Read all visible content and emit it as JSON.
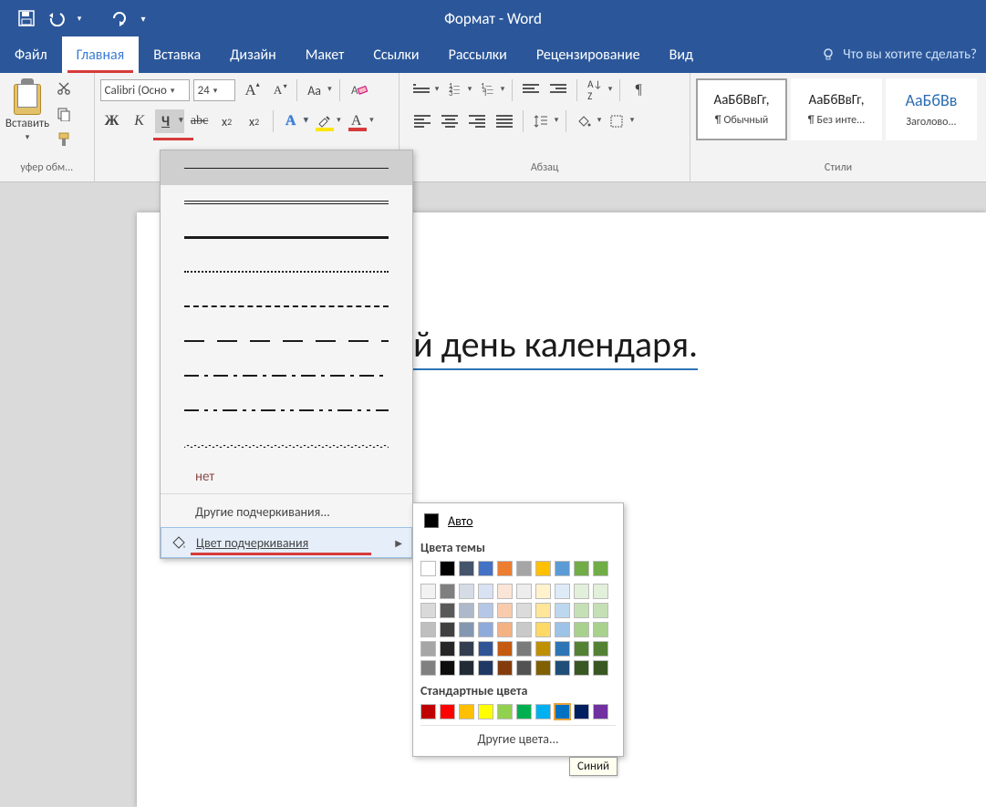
{
  "window": {
    "title": "Формат - Word"
  },
  "qat": {
    "save": "save",
    "undo": "undo",
    "redo": "redo"
  },
  "tabs": {
    "file": "Файл",
    "home": "Главная",
    "insert": "Вставка",
    "design": "Дизайн",
    "layout": "Макет",
    "references": "Ссылки",
    "mailings": "Рассылки",
    "review": "Рецензирование",
    "view": "Вид",
    "tellme_placeholder": "Что вы хотите сделать?"
  },
  "ribbon": {
    "clipboard": {
      "paste": "Вставить",
      "label": "уфер обм..."
    },
    "font": {
      "font_name": "Calibri (Осно",
      "font_size": "24",
      "case_label": "Aa",
      "bold": "Ж",
      "italic": "К",
      "underline": "Ч",
      "strike": "abc",
      "sub": "x",
      "sup": "x"
    },
    "paragraph": {
      "label": "Абзац"
    },
    "styles": {
      "label": "Стили",
      "items": [
        {
          "sample": "АаБбВвГг,",
          "name": "¶ Обычный"
        },
        {
          "sample": "АаБбВвГг,",
          "name": "¶ Без инте..."
        },
        {
          "sample": "АаБбВв",
          "name": "Заголово..."
        }
      ]
    }
  },
  "document": {
    "visible_text": "й день календаря."
  },
  "underline_menu": {
    "none": "нет",
    "more_underlines": "Другие подчеркивания...",
    "underline_color": "Цвет подчеркивания"
  },
  "color_menu": {
    "auto": "Авто",
    "theme_label": "Цвета темы",
    "standard_label": "Стандартные цвета",
    "more_colors": "Другие цвета...",
    "tooltip": "Синий",
    "theme_row0": [
      "#ffffff",
      "#000000",
      "#44546a",
      "#4472c4",
      "#ed7d31",
      "#a5a5a5",
      "#ffc000",
      "#5b9bd5",
      "#70ad47",
      "#70ad47"
    ],
    "theme_shades": [
      [
        "#f2f2f2",
        "#7f7f7f",
        "#d6dce5",
        "#d9e2f3",
        "#fbe5d6",
        "#ededed",
        "#fff2cc",
        "#deebf7",
        "#e2efda",
        "#e2efda"
      ],
      [
        "#d9d9d9",
        "#595959",
        "#adb9ca",
        "#b4c7e7",
        "#f8cbad",
        "#dbdbdb",
        "#ffe699",
        "#bdd7ee",
        "#c5e0b4",
        "#c5e0b4"
      ],
      [
        "#bfbfbf",
        "#404040",
        "#8497b0",
        "#8eaadb",
        "#f4b183",
        "#c9c9c9",
        "#ffd966",
        "#9dc3e6",
        "#a9d18e",
        "#a9d18e"
      ],
      [
        "#a6a6a6",
        "#262626",
        "#333f50",
        "#2f5597",
        "#c55a11",
        "#7b7b7b",
        "#bf9000",
        "#2e75b6",
        "#548235",
        "#548235"
      ],
      [
        "#808080",
        "#0d0d0d",
        "#222a35",
        "#1f3864",
        "#843c0c",
        "#525252",
        "#806000",
        "#1f4e79",
        "#385723",
        "#385723"
      ]
    ],
    "standard": [
      "#c00000",
      "#ff0000",
      "#ffc000",
      "#ffff00",
      "#92d050",
      "#00b050",
      "#00b0f0",
      "#0070c0",
      "#002060",
      "#7030a0"
    ],
    "selected_standard_index": 7
  }
}
